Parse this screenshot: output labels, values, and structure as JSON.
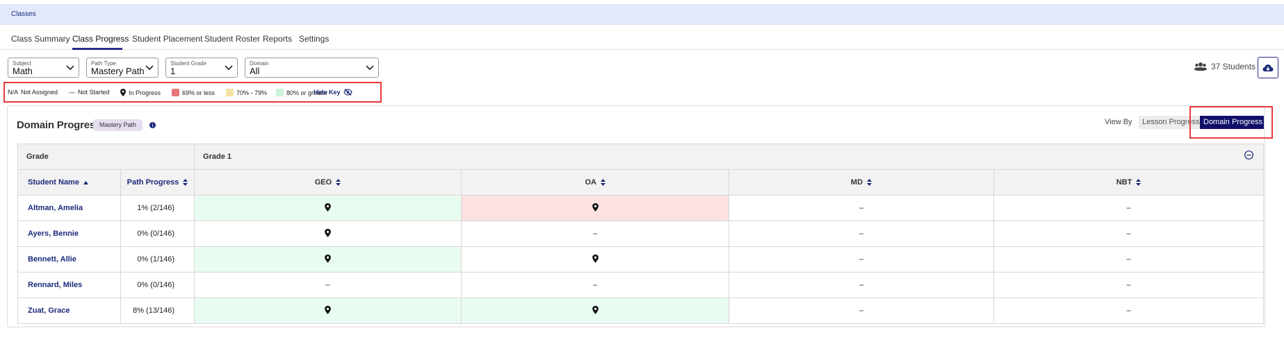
{
  "topbar": {
    "title": "Classes"
  },
  "tabs": [
    {
      "label": "Class Summary"
    },
    {
      "label": "Class Progress",
      "active": true
    },
    {
      "label": "Student Placement"
    },
    {
      "label": "Student Roster"
    },
    {
      "label": "Reports"
    },
    {
      "label": "Settings"
    }
  ],
  "filters": {
    "subject": {
      "label": "Subject",
      "value": "Math"
    },
    "path_type": {
      "label": "Path Type",
      "value": "Mastery Path"
    },
    "student_grade": {
      "label": "Student Grade",
      "value": "1"
    },
    "domain": {
      "label": "Domain",
      "value": "All"
    }
  },
  "students_count": "37 Students",
  "key": {
    "na_code": "N/A",
    "not_assigned": "Not Assigned",
    "not_started_dash": "—",
    "not_started": "Not Started",
    "in_progress": "In Progress",
    "low": "69% or less",
    "mid": "70% - 79%",
    "high": "80% or greater",
    "hide_key": "Hide Key",
    "colors": {
      "low": "#e8757c",
      "mid": "#f3e3a0",
      "high": "#c9f3da"
    }
  },
  "card": {
    "title": "Domain Progress",
    "badge": "Mastery Path",
    "view_by_label": "View By",
    "view_lesson": "Lesson Progress",
    "view_domain": "Domain Progress"
  },
  "table": {
    "grade_header": "Grade",
    "grade_value": "Grade 1",
    "columns": {
      "name": "Student Name",
      "path": "Path Progress",
      "geo": "GEO",
      "oa": "OA",
      "md": "MD",
      "nbt": "NBT"
    },
    "rows": [
      {
        "name": "Altman, Amelia",
        "path": "1% (2/146)",
        "md": "–",
        "nbt": "–"
      },
      {
        "name": "Ayers, Bennie",
        "path": "0% (0/146)",
        "oa": "–",
        "md": "–",
        "nbt": "–"
      },
      {
        "name": "Bennett, Allie",
        "path": "0% (1/146)",
        "md": "–",
        "nbt": "–"
      },
      {
        "name": "Rennard, Miles",
        "path": "0% (0/146)",
        "geo": "–",
        "oa": "–",
        "md": "–",
        "nbt": "–"
      },
      {
        "name": "Zuat, Grace",
        "path": "8% (13/146)",
        "md": "–",
        "nbt": "–"
      }
    ]
  }
}
